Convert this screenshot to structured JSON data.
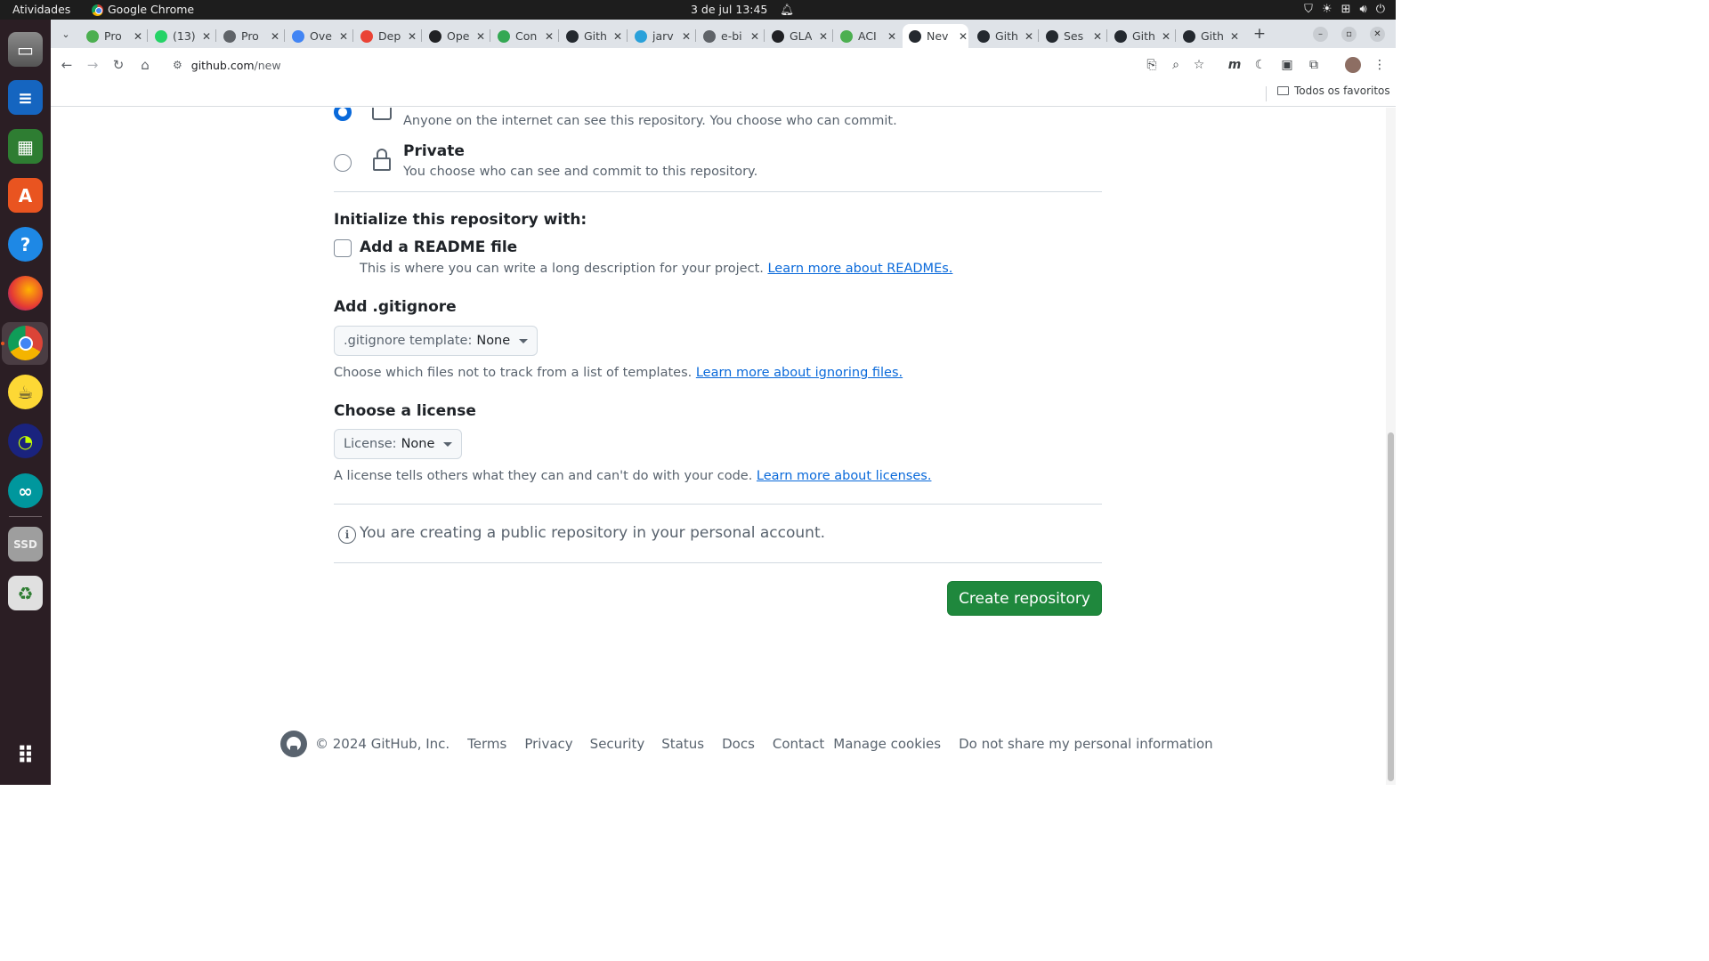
{
  "topbar": {
    "activities": "Atividades",
    "app_name": "Google Chrome",
    "clock": "3 de jul  13:45"
  },
  "tabs": [
    {
      "label": "Pro",
      "icon": "green-leaf-icon",
      "color": "#4caf50"
    },
    {
      "label": "(13)",
      "icon": "whatsapp-icon",
      "color": "#25d366"
    },
    {
      "label": "Pro",
      "icon": "globe-icon",
      "color": "#5f6368"
    },
    {
      "label": "Ove",
      "icon": "docs-icon",
      "color": "#4285f4"
    },
    {
      "label": "Dep",
      "icon": "gmail-icon",
      "color": "#ea4335"
    },
    {
      "label": "Ope",
      "icon": "openai-icon",
      "color": "#202124"
    },
    {
      "label": "Con",
      "icon": "leaf-icon",
      "color": "#34a853"
    },
    {
      "label": "Gith",
      "icon": "github-icon",
      "color": "#24292f"
    },
    {
      "label": "jarv",
      "icon": "telegram-icon",
      "color": "#2aa1da"
    },
    {
      "label": "e-bi",
      "icon": "globe-icon",
      "color": "#5f6368"
    },
    {
      "label": "GLA",
      "icon": "m-icon",
      "color": "#202124"
    },
    {
      "label": "ACI",
      "icon": "green-leaf-icon",
      "color": "#4caf50"
    },
    {
      "label": "Nev",
      "icon": "github-icon",
      "color": "#24292f",
      "active": true
    },
    {
      "label": "Gith",
      "icon": "github-icon",
      "color": "#24292f"
    },
    {
      "label": "Ses",
      "icon": "github-icon",
      "color": "#24292f"
    },
    {
      "label": "Gith",
      "icon": "github-icon",
      "color": "#24292f"
    },
    {
      "label": "Gith",
      "icon": "github-icon",
      "color": "#24292f"
    }
  ],
  "new_tab": "+",
  "address": {
    "host": "github.com",
    "path": "/new"
  },
  "bookmarks": {
    "all_label": "Todos os favoritos"
  },
  "visibility": {
    "public_desc": "Anyone on the internet can see this repository. You choose who can commit.",
    "private_title": "Private",
    "private_desc": "You choose who can see and commit to this repository."
  },
  "init": {
    "title": "Initialize this repository with:",
    "readme_label": "Add a README file",
    "readme_desc": "This is where you can write a long description for your project.",
    "readme_link": "Learn more about READMEs."
  },
  "gitignore": {
    "title": "Add .gitignore",
    "select_prefix": ".gitignore template:",
    "select_value": "None",
    "desc": "Choose which files not to track from a list of templates.",
    "link": "Learn more about ignoring files."
  },
  "license": {
    "title": "Choose a license",
    "select_prefix": "License:",
    "select_value": "None",
    "desc": "A license tells others what they can and can't do with your code.",
    "link": "Learn more about licenses."
  },
  "info_message": "You are creating a public repository in your personal account.",
  "create_button": "Create repository",
  "footer": {
    "copyright": "© 2024 GitHub, Inc.",
    "links": [
      "Terms",
      "Privacy",
      "Security",
      "Status",
      "Docs",
      "Contact",
      "Manage cookies",
      "Do not share my personal information"
    ]
  },
  "colors": {
    "primary_button": "#1f883d",
    "link": "#0969da",
    "radio_checked": "#0969da"
  }
}
